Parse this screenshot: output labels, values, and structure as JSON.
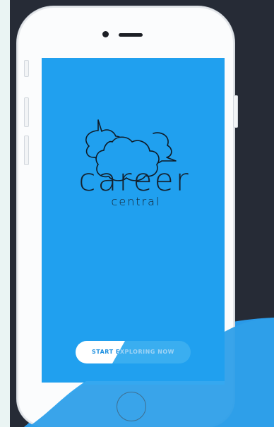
{
  "app": {
    "brand_name": "career",
    "brand_subtitle": "central"
  },
  "cta": {
    "label": "START EXPLORING NOW"
  },
  "colors": {
    "screen": "#20a0ef",
    "stage": "#262b36",
    "wave": "#2a9ae9",
    "brand_text": "#14212e",
    "page_bg": "#eaf4f3"
  },
  "icons": {
    "logo": "speech-clouds-icon",
    "home": "home-button-icon",
    "camera": "camera-icon",
    "speaker": "speaker-icon"
  }
}
